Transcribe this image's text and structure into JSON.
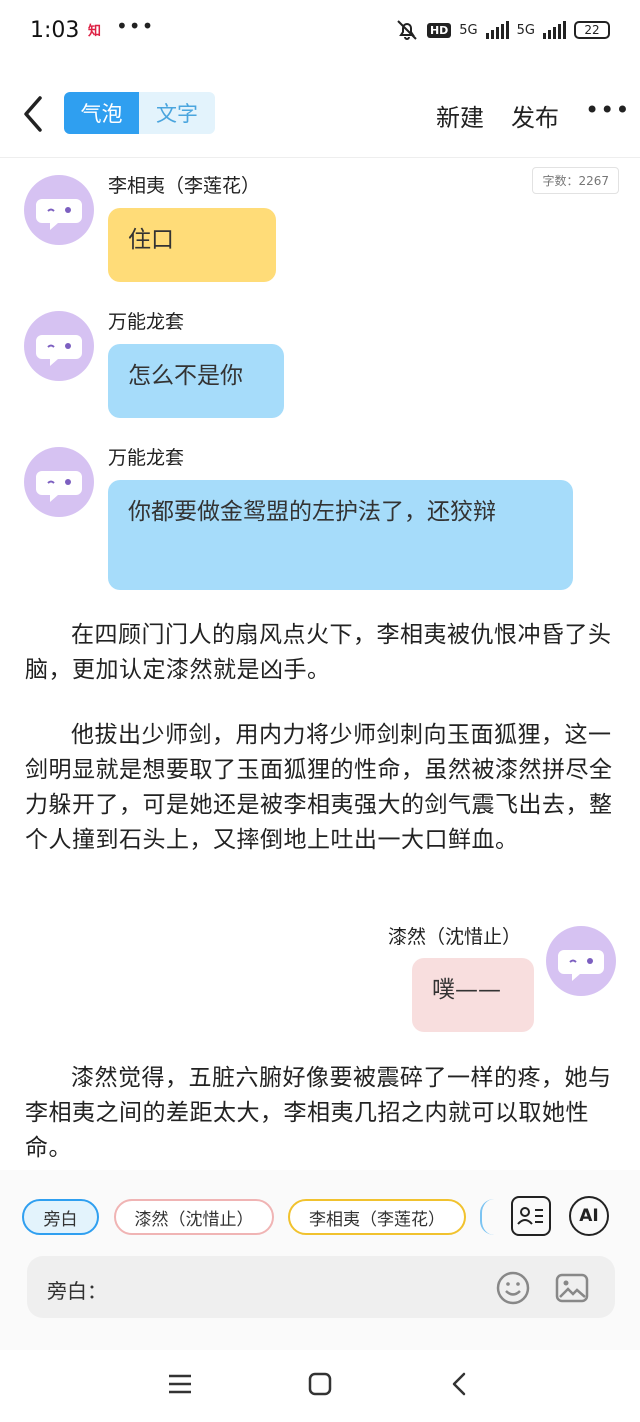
{
  "status_bar": {
    "time": "1:03",
    "app_icon": "知",
    "more_dots": "•••",
    "hd": "HD",
    "net1": "5G",
    "net2": "5G",
    "battery": "22",
    "mute_icon": "bell-off-icon"
  },
  "header": {
    "tab_bubble": "气泡",
    "tab_text": "文字",
    "new_label": "新建",
    "publish_label": "发布",
    "more_label": "•••"
  },
  "word_count": "字数：2267",
  "chat": [
    {
      "speaker": "李相夷（李莲花）",
      "text": "住口",
      "color": "#ffdc78"
    },
    {
      "speaker": "万能龙套",
      "text": "怎么不是你",
      "color": "#a6dcfa"
    },
    {
      "speaker": "万能龙套",
      "text": "你都要做金鸳盟的左护法了，还狡辩",
      "color": "#a6dcfa"
    }
  ],
  "narration": [
    "在四顾门门人的扇风点火下，李相夷被仇恨冲昏了头脑，更加认定漆然就是凶手。",
    "他拔出少师剑，用内力将少师剑刺向玉面狐狸，这一剑明显就是想要取了玉面狐狸的性命，虽然被漆然拼尽全力躲开了，可是她还是被李相夷强大的剑气震飞出去，整个人撞到石头上，又摔倒地上吐出一大口鲜血。",
    "漆然觉得，五脏六腑好像要被震碎了一样的疼，她与李相夷之间的差距太大，李相夷几招之内就可以取她性命。"
  ],
  "right_chat": {
    "speaker": "漆然（沈惜止）",
    "text": "噗——",
    "color": "#f8dede"
  },
  "roles": [
    {
      "label": "旁白",
      "border": "#2f9ff0",
      "bg": "#e3f3fc"
    },
    {
      "label": "漆然（沈惜止）",
      "border": "#f0b4b4",
      "bg": "#ffffff"
    },
    {
      "label": "李相夷（李莲花）",
      "border": "#f1c22e",
      "bg": "#ffffff"
    }
  ],
  "role_manage_icon": "contact-card-icon",
  "ai_label": "AI",
  "input": {
    "label": "旁白："
  },
  "colors": {
    "accent": "#2f9ff0",
    "avatar": "#d6c2f2"
  }
}
